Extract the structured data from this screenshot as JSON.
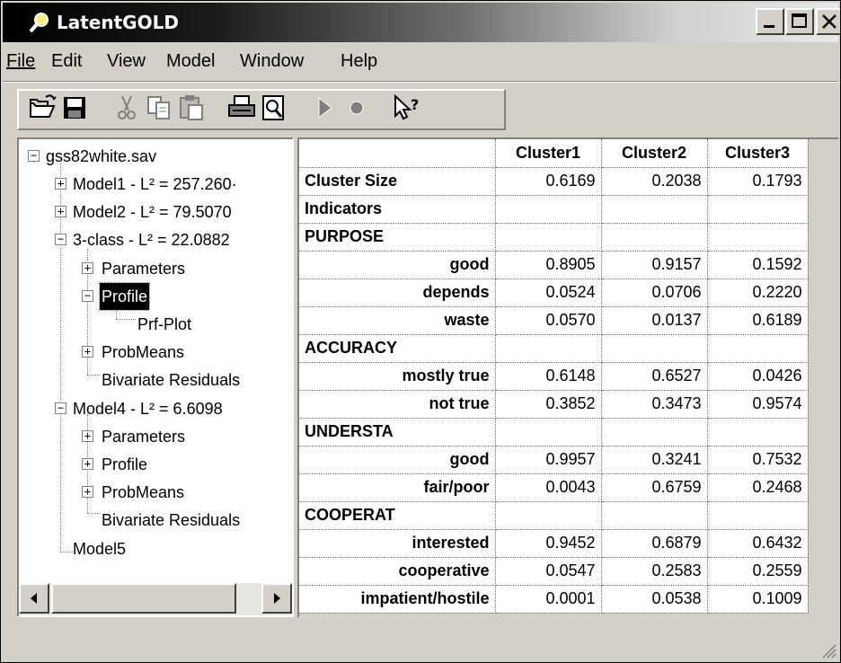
{
  "window": {
    "title": "LatentGOLD"
  },
  "menu": [
    {
      "label": "File"
    },
    {
      "label": "Edit"
    },
    {
      "label": "View"
    },
    {
      "label": "Model"
    },
    {
      "label": "Window"
    },
    {
      "label": "Help"
    }
  ],
  "toolbar": {
    "buttons": [
      "open-icon",
      "save-icon",
      "cut-icon",
      "copy-icon",
      "paste-icon",
      "print-icon",
      "print-preview-icon",
      "run-icon",
      "stop-icon",
      "context-help-icon"
    ]
  },
  "tree": {
    "root": "gss82white.sav",
    "model1": "Model1 - L² = 257.260·",
    "model2": "Model2 - L² = 79.5070",
    "class3": "3-class - L² = 22.0882",
    "c3_parameters": "Parameters",
    "c3_profile": "Profile",
    "c3_prfplot": "Prf-Plot",
    "c3_probmeans": "ProbMeans",
    "c3_bivariate": "Bivariate Residuals",
    "model4": "Model4 - L² = 6.6098",
    "m4_parameters": "Parameters",
    "m4_profile": "Profile",
    "m4_probmeans": "ProbMeans",
    "m4_bivariate": "Bivariate Residuals",
    "model5": "Model5",
    "expanders": {
      "plus": "+",
      "minus": "−"
    }
  },
  "grid": {
    "columns": [
      "Cluster1",
      "Cluster2",
      "Cluster3"
    ],
    "rows": [
      {
        "label": "Cluster Size",
        "values": [
          "0.6169",
          "0.2038",
          "0.1793"
        ]
      },
      {
        "label": "Indicators",
        "values": [
          "",
          "",
          ""
        ]
      },
      {
        "label": "PURPOSE",
        "values": [
          "",
          "",
          ""
        ]
      },
      {
        "label": "good",
        "values": [
          "0.8905",
          "0.9157",
          "0.1592"
        ]
      },
      {
        "label": "depends",
        "values": [
          "0.0524",
          "0.0706",
          "0.2220"
        ]
      },
      {
        "label": "waste",
        "values": [
          "0.0570",
          "0.0137",
          "0.6189"
        ]
      },
      {
        "label": "ACCURACY",
        "values": [
          "",
          "",
          ""
        ]
      },
      {
        "label": "mostly true",
        "values": [
          "0.6148",
          "0.6527",
          "0.0426"
        ]
      },
      {
        "label": "not true",
        "values": [
          "0.3852",
          "0.3473",
          "0.9574"
        ]
      },
      {
        "label": "UNDERSTA",
        "values": [
          "",
          "",
          ""
        ]
      },
      {
        "label": "good",
        "values": [
          "0.9957",
          "0.3241",
          "0.7532"
        ]
      },
      {
        "label": "fair/poor",
        "values": [
          "0.0043",
          "0.6759",
          "0.2468"
        ]
      },
      {
        "label": "COOPERAT",
        "values": [
          "",
          "",
          ""
        ]
      },
      {
        "label": "interested",
        "values": [
          "0.9452",
          "0.6879",
          "0.6432"
        ]
      },
      {
        "label": "cooperative",
        "values": [
          "0.0547",
          "0.2583",
          "0.2559"
        ]
      },
      {
        "label": "impatient/hostile",
        "values": [
          "0.0001",
          "0.0538",
          "0.1009"
        ]
      }
    ]
  },
  "colors": {
    "face": "#d4d0c8",
    "selection": "#000000",
    "titlebar_start": "#000000",
    "titlebar_end": "#e8e8e8"
  }
}
